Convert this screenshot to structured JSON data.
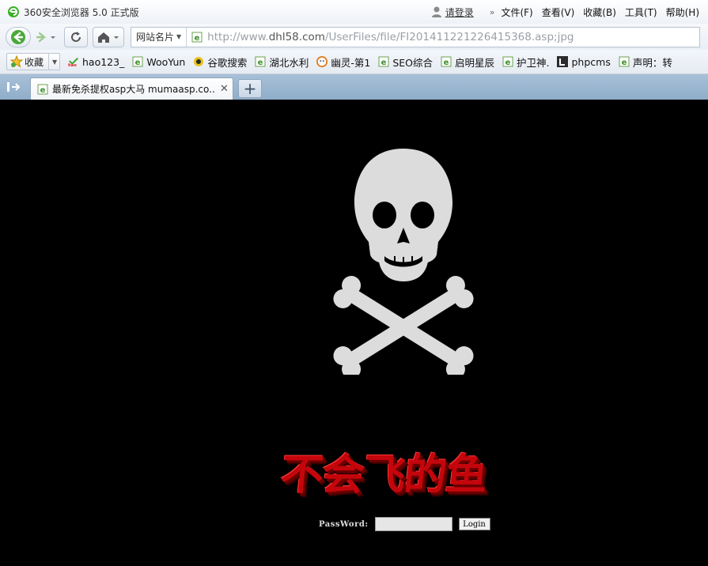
{
  "window": {
    "app_title": "360安全浏览器 5.0 正式版",
    "login_link": "请登录",
    "menu": [
      "文件(F)",
      "查看(V)",
      "收藏(B)",
      "工具(T)",
      "帮助(H)"
    ]
  },
  "navbar": {
    "address_dropdown": "网站名片",
    "url_prefix": "http://www.",
    "url_domain": "dhl58.com",
    "url_path": "/UserFiles/file/FI20141122122641536​8.asp;jpg"
  },
  "bookmarks": {
    "favorites_label": "收藏",
    "items": [
      {
        "label": "hao123_",
        "icon": "hao123-icon"
      },
      {
        "label": "WooYun",
        "icon": "ie-page-icon"
      },
      {
        "label": "谷歌搜索",
        "icon": "google-icon"
      },
      {
        "label": "湖北水利",
        "icon": "ie-page-icon"
      },
      {
        "label": "幽灵-第1",
        "icon": "ghost-icon"
      },
      {
        "label": "SEO综合",
        "icon": "ie-page-icon"
      },
      {
        "label": "启明星辰",
        "icon": "ie-page-icon"
      },
      {
        "label": "护卫神.",
        "icon": "ie-page-icon"
      },
      {
        "label": "phpcms",
        "icon": "l-logo-icon"
      },
      {
        "label": "声明：转",
        "icon": "ie-page-icon"
      }
    ]
  },
  "tabs": [
    {
      "title": "最新免杀提权asp大马 mumaasp.co..."
    }
  ],
  "page": {
    "brand_title": "不会飞的鱼",
    "password_label": "PassWord:",
    "password_value": "",
    "login_button": "Login"
  }
}
